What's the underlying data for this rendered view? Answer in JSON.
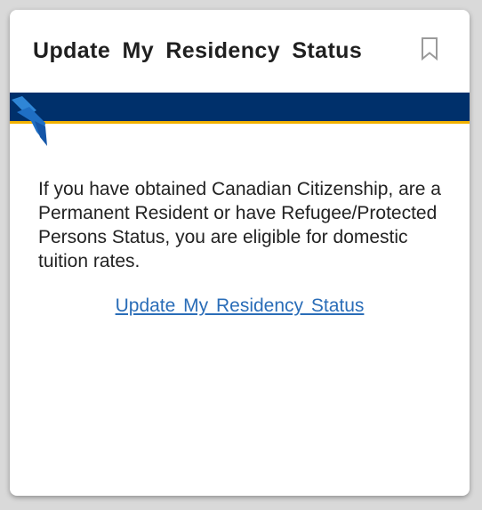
{
  "card": {
    "title": "Update My Residency Status",
    "bookmark_icon": "bookmark-icon",
    "body_text": "If you have obtained Canadian Citizenship, are a Permanent Resident or have Refugee/Protected Persons Status, you are eligible for domestic tuition rates.",
    "link_label": "Update My Residency Status"
  },
  "colors": {
    "banner": "#00306b",
    "banner_accent": "#f2b200",
    "link": "#2a6db8"
  }
}
